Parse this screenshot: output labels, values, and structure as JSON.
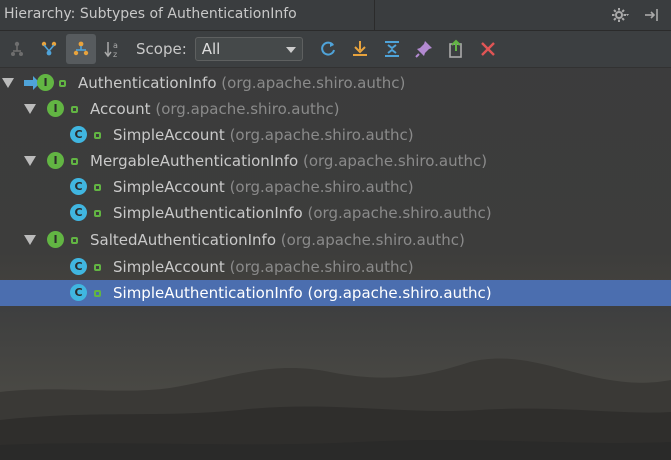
{
  "window": {
    "title": "Hierarchy: Subtypes of AuthenticationInfo",
    "icons": [
      "gear-icon",
      "pin-to-side-icon"
    ]
  },
  "toolbar": {
    "tools": [
      "type-hierarchy-icon",
      "supertypes-icon",
      "subtypes-icon",
      "sort-alphabetically-icon"
    ],
    "scope_label": "Scope:",
    "scope_value": "All",
    "actions": [
      "refresh-icon",
      "autoscroll-to-source-icon",
      "expand-all-icon",
      "pin-icon",
      "export-icon",
      "close-icon"
    ]
  },
  "tree": {
    "root": {
      "name": "AuthenticationInfo",
      "package": "(org.apache.shiro.authc)",
      "kind": "interface"
    },
    "nodes": [
      {
        "name": "Account",
        "package": "(org.apache.shiro.authc)",
        "kind": "interface",
        "children": [
          {
            "name": "SimpleAccount",
            "package": "(org.apache.shiro.authc)",
            "kind": "class"
          }
        ]
      },
      {
        "name": "MergableAuthenticationInfo",
        "package": "(org.apache.shiro.authc)",
        "kind": "interface",
        "children": [
          {
            "name": "SimpleAccount",
            "package": "(org.apache.shiro.authc)",
            "kind": "class"
          },
          {
            "name": "SimpleAuthenticationInfo",
            "package": "(org.apache.shiro.authc)",
            "kind": "class"
          }
        ]
      },
      {
        "name": "SaltedAuthenticationInfo",
        "package": "(org.apache.shiro.authc)",
        "kind": "interface",
        "children": [
          {
            "name": "SimpleAccount",
            "package": "(org.apache.shiro.authc)",
            "kind": "class"
          },
          {
            "name": "SimpleAuthenticationInfo",
            "package": "(org.apache.shiro.authc)",
            "kind": "class",
            "selected": true
          }
        ]
      }
    ]
  },
  "colors": {
    "selection": "#4b6eaf",
    "interface_badge": "#62b543",
    "class_badge": "#40b6e0"
  }
}
